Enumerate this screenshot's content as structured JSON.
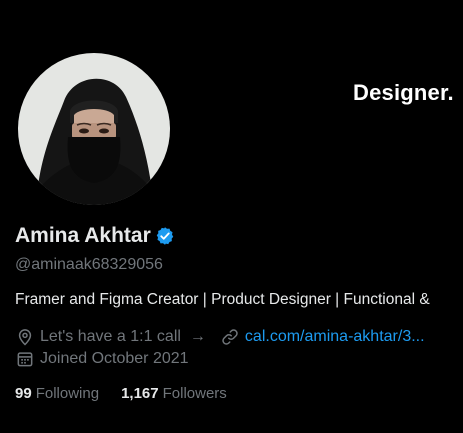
{
  "banner": {
    "text": "Designer."
  },
  "profile": {
    "name": "Amina Akhtar",
    "handle": "@aminaak68329056",
    "bio": "Framer and Figma Creator | Product Designer | Functional &",
    "location": "Let's have a 1:1 call",
    "location_arrow": "→",
    "website": "cal.com/amina-akhtar/3...",
    "joined": "Joined October 2021"
  },
  "stats": {
    "following_count": "99",
    "following_label": "Following",
    "followers_count": "1,167",
    "followers_label": "Followers"
  },
  "icons": {
    "verified": "verified-badge-icon",
    "location": "location-pin-icon",
    "link": "link-icon",
    "calendar": "calendar-icon"
  },
  "colors": {
    "background": "#000000",
    "primary_text": "#e7e9ea",
    "secondary_text": "#71767b",
    "link": "#1d9bf0",
    "verified": "#1d9bf0"
  }
}
